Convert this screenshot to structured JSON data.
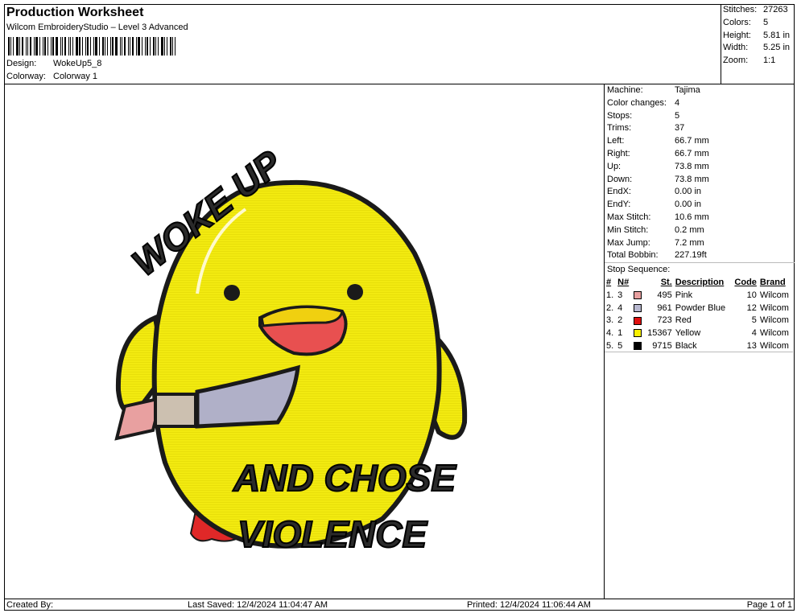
{
  "header": {
    "title": "Production Worksheet",
    "subtitle": "Wilcom EmbroideryStudio – Level 3 Advanced",
    "design_label": "Design:",
    "design_value": "WokeUp5_8",
    "colorway_label": "Colorway:",
    "colorway_value": "Colorway 1"
  },
  "summary": {
    "stitches_label": "Stitches:",
    "stitches_value": "27263",
    "colors_label": "Colors:",
    "colors_value": "5",
    "height_label": "Height:",
    "height_value": "5.81 in",
    "width_label": "Width:",
    "width_value": "5.25 in",
    "zoom_label": "Zoom:",
    "zoom_value": "1:1"
  },
  "info": [
    {
      "label": "Machine:",
      "value": "Tajima"
    },
    {
      "label": "Color changes:",
      "value": "4"
    },
    {
      "label": "Stops:",
      "value": "5"
    },
    {
      "label": "Trims:",
      "value": "37"
    },
    {
      "label": "Left:",
      "value": "66.7 mm"
    },
    {
      "label": "Right:",
      "value": "66.7 mm"
    },
    {
      "label": "Up:",
      "value": "73.8 mm"
    },
    {
      "label": "Down:",
      "value": "73.8 mm"
    },
    {
      "label": "EndX:",
      "value": "0.00 in"
    },
    {
      "label": "EndY:",
      "value": "0.00 in"
    },
    {
      "label": "Max Stitch:",
      "value": "10.6 mm"
    },
    {
      "label": "Min Stitch:",
      "value": "0.2 mm"
    },
    {
      "label": "Max Jump:",
      "value": "7.2 mm"
    },
    {
      "label": "Total Bobbin:",
      "value": "227.19ft"
    }
  ],
  "stop_sequence": {
    "title": "Stop Sequence:",
    "headers": {
      "num": "#",
      "n": "N#",
      "st": "St.",
      "desc": "Description",
      "code": "Code",
      "brand": "Brand"
    },
    "rows": [
      {
        "num": "1.",
        "n": "3",
        "color": "#e8a0a0",
        "st": "495",
        "desc": "Pink",
        "code": "10",
        "brand": "Wilcom"
      },
      {
        "num": "2.",
        "n": "4",
        "color": "#b8b8d0",
        "st": "961",
        "desc": "Powder Blue",
        "code": "12",
        "brand": "Wilcom"
      },
      {
        "num": "3.",
        "n": "2",
        "color": "#e01010",
        "st": "723",
        "desc": "Red",
        "code": "5",
        "brand": "Wilcom"
      },
      {
        "num": "4.",
        "n": "1",
        "color": "#f8f000",
        "st": "15367",
        "desc": "Yellow",
        "code": "4",
        "brand": "Wilcom"
      },
      {
        "num": "5.",
        "n": "5",
        "color": "#000000",
        "st": "9715",
        "desc": "Black",
        "code": "13",
        "brand": "Wilcom"
      }
    ]
  },
  "artwork": {
    "top_text": "WOKE UP",
    "bottom_text_1": "AND CHOSE",
    "bottom_text_2": "VIOLENCE"
  },
  "footer": {
    "created": "Created By:",
    "saved": "Last Saved: 12/4/2024 11:04:47 AM",
    "printed": "Printed: 12/4/2024 11:06:44 AM",
    "page": "Page 1 of 1"
  }
}
